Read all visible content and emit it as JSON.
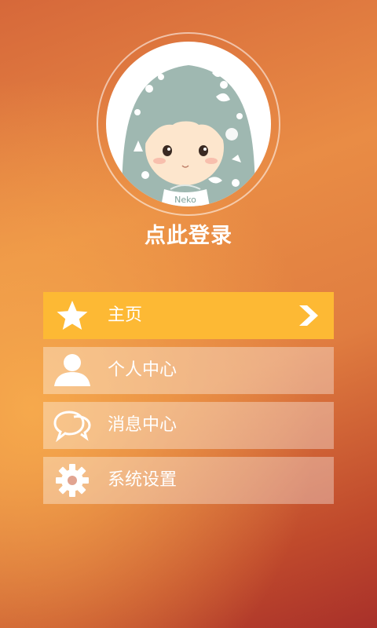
{
  "profile": {
    "avatar_badge": "Neko",
    "login_label": "点此登录"
  },
  "menu": {
    "items": [
      {
        "label": "主页",
        "icon": "star-icon",
        "active": true
      },
      {
        "label": "个人中心",
        "icon": "user-icon",
        "active": false
      },
      {
        "label": "消息中心",
        "icon": "chat-icon",
        "active": false
      },
      {
        "label": "系统设置",
        "icon": "gear-icon",
        "active": false
      }
    ]
  },
  "colors": {
    "active_item": "#fdb934",
    "text": "#ffffff",
    "avatar_hair": "#9fb8b1"
  }
}
